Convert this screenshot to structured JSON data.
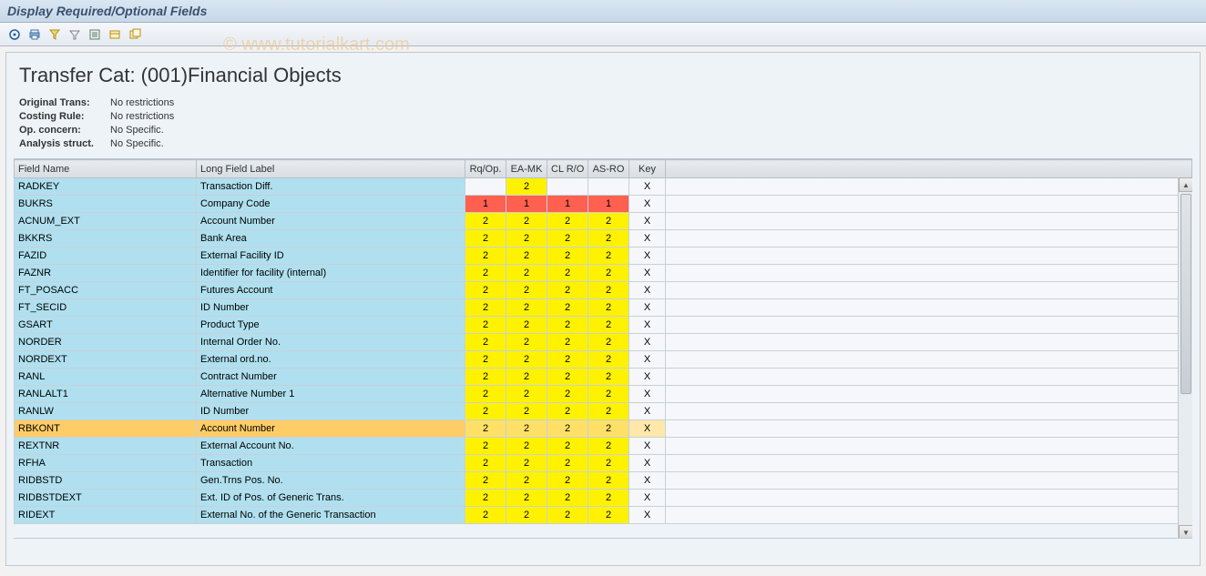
{
  "window_title": "Display Required/Optional Fields",
  "watermark": "© www.tutorialkart.com",
  "heading": "Transfer Cat: (001)Financial Objects",
  "meta": [
    {
      "label": "Original Trans:",
      "value": "No restrictions"
    },
    {
      "label": "Costing Rule:",
      "value": "No restrictions"
    },
    {
      "label": "Op. concern:",
      "value": "No Specific."
    },
    {
      "label": "Analysis struct.",
      "value": "No Specific."
    }
  ],
  "columns": {
    "field_name": "Field Name",
    "long_label": "Long Field Label",
    "rqop": "Rq/Op.",
    "eamk": "EA-MK",
    "clro": "CL R/O",
    "asro": "AS-RO",
    "key": "Key"
  },
  "rows": [
    {
      "fn": "RADKEY",
      "ll": "Transaction Diff.",
      "rq": "",
      "ea": "2",
      "cl": "",
      "as": "",
      "key": "X",
      "sel": false,
      "rq_c": "blank",
      "ea_c": "yellow",
      "cl_c": "blank",
      "as_c": "blank"
    },
    {
      "fn": "BUKRS",
      "ll": "Company Code",
      "rq": "1",
      "ea": "1",
      "cl": "1",
      "as": "1",
      "key": "X",
      "sel": false,
      "rq_c": "red",
      "ea_c": "red",
      "cl_c": "red",
      "as_c": "red"
    },
    {
      "fn": "ACNUM_EXT",
      "ll": "Account Number",
      "rq": "2",
      "ea": "2",
      "cl": "2",
      "as": "2",
      "key": "X",
      "sel": false,
      "rq_c": "yellow",
      "ea_c": "yellow",
      "cl_c": "yellow",
      "as_c": "yellow"
    },
    {
      "fn": "BKKRS",
      "ll": "Bank Area",
      "rq": "2",
      "ea": "2",
      "cl": "2",
      "as": "2",
      "key": "X",
      "sel": false,
      "rq_c": "yellow",
      "ea_c": "yellow",
      "cl_c": "yellow",
      "as_c": "yellow"
    },
    {
      "fn": "FAZID",
      "ll": "External Facility ID",
      "rq": "2",
      "ea": "2",
      "cl": "2",
      "as": "2",
      "key": "X",
      "sel": false,
      "rq_c": "yellow",
      "ea_c": "yellow",
      "cl_c": "yellow",
      "as_c": "yellow"
    },
    {
      "fn": "FAZNR",
      "ll": "Identifier for facility (internal)",
      "rq": "2",
      "ea": "2",
      "cl": "2",
      "as": "2",
      "key": "X",
      "sel": false,
      "rq_c": "yellow",
      "ea_c": "yellow",
      "cl_c": "yellow",
      "as_c": "yellow"
    },
    {
      "fn": "FT_POSACC",
      "ll": "Futures Account",
      "rq": "2",
      "ea": "2",
      "cl": "2",
      "as": "2",
      "key": "X",
      "sel": false,
      "rq_c": "yellow",
      "ea_c": "yellow",
      "cl_c": "yellow",
      "as_c": "yellow"
    },
    {
      "fn": "FT_SECID",
      "ll": "ID Number",
      "rq": "2",
      "ea": "2",
      "cl": "2",
      "as": "2",
      "key": "X",
      "sel": false,
      "rq_c": "yellow",
      "ea_c": "yellow",
      "cl_c": "yellow",
      "as_c": "yellow"
    },
    {
      "fn": "GSART",
      "ll": "Product Type",
      "rq": "2",
      "ea": "2",
      "cl": "2",
      "as": "2",
      "key": "X",
      "sel": false,
      "rq_c": "yellow",
      "ea_c": "yellow",
      "cl_c": "yellow",
      "as_c": "yellow"
    },
    {
      "fn": "NORDER",
      "ll": "Internal Order No.",
      "rq": "2",
      "ea": "2",
      "cl": "2",
      "as": "2",
      "key": "X",
      "sel": false,
      "rq_c": "yellow",
      "ea_c": "yellow",
      "cl_c": "yellow",
      "as_c": "yellow"
    },
    {
      "fn": "NORDEXT",
      "ll": "External ord.no.",
      "rq": "2",
      "ea": "2",
      "cl": "2",
      "as": "2",
      "key": "X",
      "sel": false,
      "rq_c": "yellow",
      "ea_c": "yellow",
      "cl_c": "yellow",
      "as_c": "yellow"
    },
    {
      "fn": "RANL",
      "ll": "Contract Number",
      "rq": "2",
      "ea": "2",
      "cl": "2",
      "as": "2",
      "key": "X",
      "sel": false,
      "rq_c": "yellow",
      "ea_c": "yellow",
      "cl_c": "yellow",
      "as_c": "yellow"
    },
    {
      "fn": "RANLALT1",
      "ll": "Alternative Number 1",
      "rq": "2",
      "ea": "2",
      "cl": "2",
      "as": "2",
      "key": "X",
      "sel": false,
      "rq_c": "yellow",
      "ea_c": "yellow",
      "cl_c": "yellow",
      "as_c": "yellow"
    },
    {
      "fn": "RANLW",
      "ll": "ID Number",
      "rq": "2",
      "ea": "2",
      "cl": "2",
      "as": "2",
      "key": "X",
      "sel": false,
      "rq_c": "yellow",
      "ea_c": "yellow",
      "cl_c": "yellow",
      "as_c": "yellow"
    },
    {
      "fn": "RBKONT",
      "ll": "Account Number",
      "rq": "2",
      "ea": "2",
      "cl": "2",
      "as": "2",
      "key": "X",
      "sel": true,
      "rq_c": "yellow",
      "ea_c": "yellow",
      "cl_c": "yellow",
      "as_c": "yellow"
    },
    {
      "fn": "REXTNR",
      "ll": "External Account No.",
      "rq": "2",
      "ea": "2",
      "cl": "2",
      "as": "2",
      "key": "X",
      "sel": false,
      "rq_c": "yellow",
      "ea_c": "yellow",
      "cl_c": "yellow",
      "as_c": "yellow"
    },
    {
      "fn": "RFHA",
      "ll": "Transaction",
      "rq": "2",
      "ea": "2",
      "cl": "2",
      "as": "2",
      "key": "X",
      "sel": false,
      "rq_c": "yellow",
      "ea_c": "yellow",
      "cl_c": "yellow",
      "as_c": "yellow"
    },
    {
      "fn": "RIDBSTD",
      "ll": "Gen.Trns Pos. No.",
      "rq": "2",
      "ea": "2",
      "cl": "2",
      "as": "2",
      "key": "X",
      "sel": false,
      "rq_c": "yellow",
      "ea_c": "yellow",
      "cl_c": "yellow",
      "as_c": "yellow"
    },
    {
      "fn": "RIDBSTDEXT",
      "ll": "Ext. ID of Pos. of Generic Trans.",
      "rq": "2",
      "ea": "2",
      "cl": "2",
      "as": "2",
      "key": "X",
      "sel": false,
      "rq_c": "yellow",
      "ea_c": "yellow",
      "cl_c": "yellow",
      "as_c": "yellow"
    },
    {
      "fn": "RIDEXT",
      "ll": "External No. of the Generic Transaction",
      "rq": "2",
      "ea": "2",
      "cl": "2",
      "as": "2",
      "key": "X",
      "sel": false,
      "rq_c": "yellow",
      "ea_c": "yellow",
      "cl_c": "yellow",
      "as_c": "yellow"
    }
  ],
  "toolbar_icons": [
    "details",
    "print",
    "filter",
    "sort",
    "export",
    "choose-layout",
    "save-layout"
  ]
}
